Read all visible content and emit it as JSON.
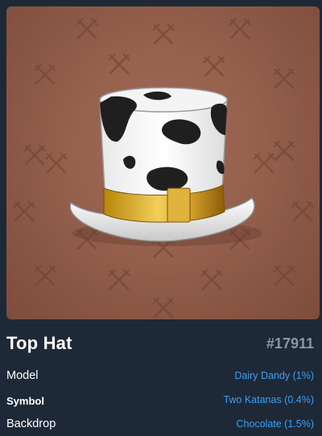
{
  "item": {
    "name": "Top Hat",
    "number": "#17911",
    "image_icon": "cow-print-top-hat-icon",
    "pattern_icon": "crossed-katanas-icon"
  },
  "attributes": [
    {
      "label": "Model",
      "value": "Dairy Dandy (1%)"
    },
    {
      "label": "Symbol",
      "value": "Two Katanas (0.4%)"
    },
    {
      "label": "Backdrop",
      "value": "Chocolate (1.5%)"
    }
  ],
  "colors": {
    "background": "#1e2937",
    "backdrop": "#94604c",
    "link": "#3a9ff5",
    "muted": "#8b95a3"
  }
}
